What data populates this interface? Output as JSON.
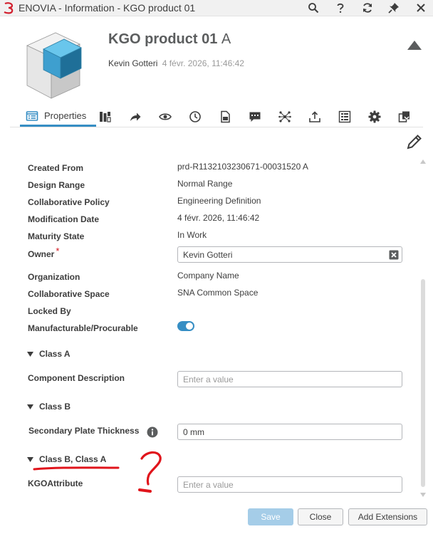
{
  "window": {
    "title": "ENOVIA - Information - KGO product 01"
  },
  "header": {
    "product_name": "KGO product 01",
    "revision": "A",
    "owner_name": "Kevin Gotteri",
    "modified_date": "4 févr. 2026, 11:46:42"
  },
  "tabs": {
    "active_label": "Properties",
    "icons": [
      "properties-icon",
      "relations-icon",
      "share-icon",
      "preview-icon",
      "history-icon",
      "document-icon",
      "comment-icon",
      "network-icon",
      "upload-icon",
      "structure-icon",
      "settings-icon",
      "compare-icon"
    ]
  },
  "properties": [
    {
      "label": "Created From",
      "value": "prd-R1132103230671-00031520 A"
    },
    {
      "label": "Design Range",
      "value": "Normal Range"
    },
    {
      "label": "Collaborative Policy",
      "value": "Engineering Definition"
    },
    {
      "label": "Modification Date",
      "value": "4 févr. 2026, 11:46:42"
    },
    {
      "label": "Maturity State",
      "value": "In Work"
    },
    {
      "label": "Owner",
      "value": "Kevin Gotteri",
      "required_mark": "*"
    },
    {
      "label": "Organization",
      "value": "Company Name"
    },
    {
      "label": "Collaborative Space",
      "value": "SNA Common Space"
    },
    {
      "label": "Locked By",
      "value": ""
    },
    {
      "label": "Manufacturable/Procurable",
      "toggle_on": true
    }
  ],
  "sections": [
    {
      "title": "Class A",
      "field_label": "Component Description",
      "field_value": "",
      "placeholder": "Enter a value"
    },
    {
      "title": "Class B",
      "field_label": "Secondary Plate Thickness",
      "field_value": "0 mm",
      "placeholder": ""
    },
    {
      "title": "Class B, Class A",
      "field_label": "KGOAttribute",
      "field_value": "",
      "placeholder": "Enter a value"
    }
  ],
  "annotation": {
    "glyph": "?",
    "color": "#e0141b"
  },
  "footer": {
    "save_label": "Save",
    "close_label": "Close",
    "extensions_label": "Add Extensions"
  },
  "colors": {
    "accent": "#368ec4",
    "required": "#d4131c",
    "save_disabled": "#a5cde8"
  }
}
